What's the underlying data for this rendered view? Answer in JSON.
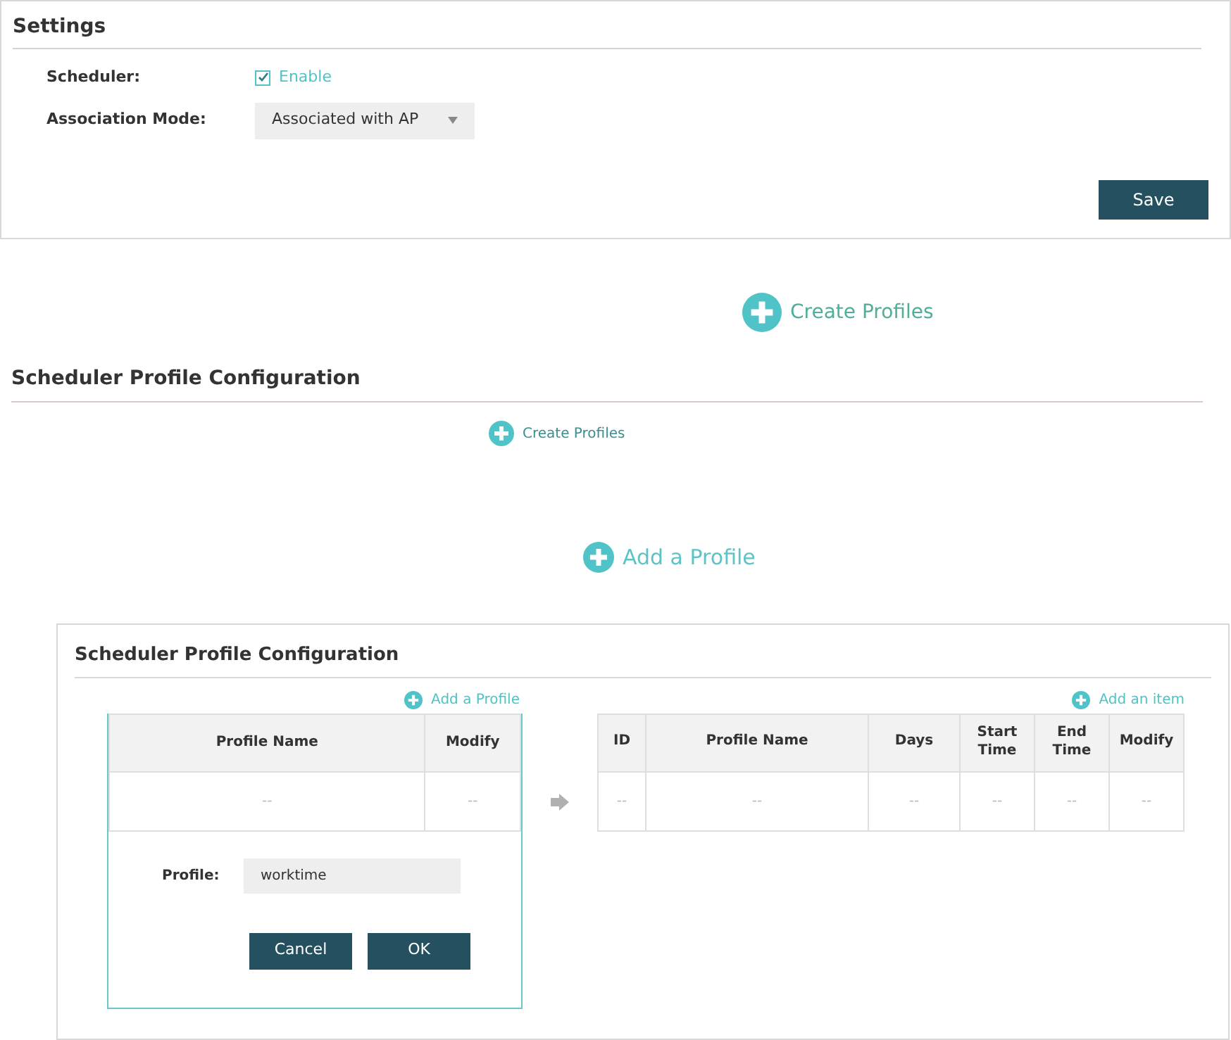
{
  "settings": {
    "title": "Settings",
    "scheduler_label": "Scheduler:",
    "scheduler": {
      "label": "Enable",
      "checked": true
    },
    "association_label": "Association Mode:",
    "association_mode": "Associated with AP",
    "save": "Save"
  },
  "create_profiles_large": "Create Profiles",
  "config_heading": "Scheduler Profile Configuration",
  "create_profiles_small": "Create Profiles",
  "add_profile_large": "Add a Profile",
  "panel": {
    "title": "Scheduler Profile Configuration",
    "add_profile": "Add a Profile",
    "add_item": "Add an item",
    "profiles_table": {
      "columns": [
        "Profile Name",
        "Modify"
      ],
      "rows": [
        [
          "--",
          "--"
        ]
      ]
    },
    "form": {
      "label": "Profile:",
      "value": "worktime",
      "cancel": "Cancel",
      "ok": "OK"
    },
    "items_table": {
      "columns": [
        "ID",
        "Profile Name",
        "Days",
        "Start Time",
        "End Time",
        "Modify"
      ],
      "rows": [
        [
          "--",
          "--",
          "--",
          "--",
          "--",
          "--"
        ]
      ]
    }
  }
}
